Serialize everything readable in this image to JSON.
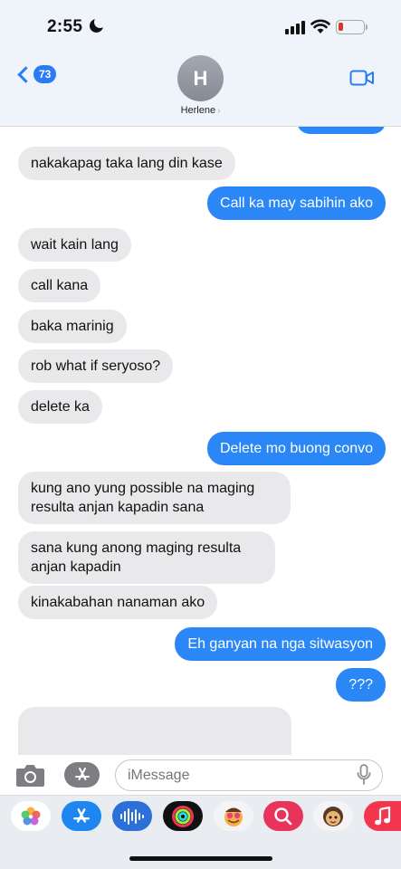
{
  "status_bar": {
    "time": "2:55"
  },
  "header": {
    "back_count": "73",
    "avatar_initial": "H",
    "contact_name": "Herlene",
    "contact_chevron": "›"
  },
  "messages": [
    {
      "direction": "in",
      "text": "nakakapag taka lang din kase"
    },
    {
      "direction": "out",
      "text": "Call ka may sabihin ako"
    },
    {
      "direction": "in",
      "text": "wait kain lang"
    },
    {
      "direction": "in",
      "text": "call kana"
    },
    {
      "direction": "in",
      "text": "baka marinig"
    },
    {
      "direction": "in",
      "text": "rob what if seryoso?"
    },
    {
      "direction": "in",
      "text": "delete ka"
    },
    {
      "direction": "out",
      "text": "Delete mo buong convo"
    },
    {
      "direction": "in",
      "text": "kung ano yung possible na maging resulta anjan kapadin sana"
    },
    {
      "direction": "in",
      "text": "sana kung anong maging resulta anjan kapadin"
    },
    {
      "direction": "in",
      "text": "kinakabahan nanaman ako"
    },
    {
      "direction": "out",
      "text": "Eh ganyan na nga sitwasyon"
    },
    {
      "direction": "out",
      "text": "???"
    }
  ],
  "input": {
    "placeholder": "iMessage"
  },
  "app_strip": [
    "photos-app",
    "app-store",
    "audio-message",
    "activity",
    "memoji-stickers",
    "image-search",
    "memoji",
    "music"
  ],
  "colors": {
    "outgoing": "#2a87f5",
    "incoming": "#e9e9eb",
    "accent": "#2a7bf6"
  }
}
